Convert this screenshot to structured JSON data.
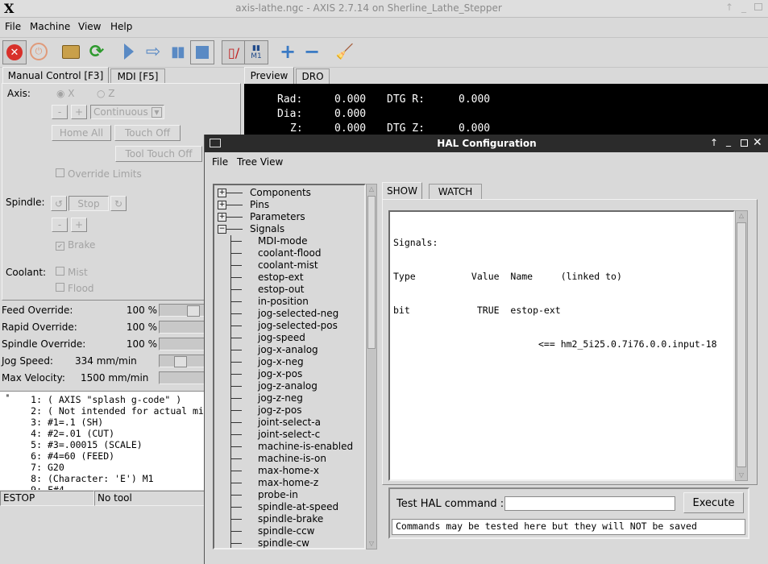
{
  "window": {
    "title": "axis-lathe.ngc - AXIS 2.7.14 on Sherline_Lathe_Stepper",
    "logo": "X"
  },
  "menubar": [
    "File",
    "Machine",
    "View",
    "Help"
  ],
  "tabs_left": {
    "manual": "Manual Control [F3]",
    "mdi": "MDI [F5]"
  },
  "tabs_right": {
    "preview": "Preview",
    "dro": "DRO"
  },
  "manual": {
    "axis_label": "Axis:",
    "axis_x": "X",
    "axis_z": "Z",
    "minus": "-",
    "plus": "+",
    "jog_mode": "Continuous",
    "home_all": "Home All",
    "touch_off": "Touch Off",
    "tool_touch_off": "Tool Touch Off",
    "override_limits": "Override Limits",
    "spindle_label": "Spindle:",
    "stop": "Stop",
    "brake": "Brake",
    "coolant_label": "Coolant:",
    "mist": "Mist",
    "flood": "Flood"
  },
  "overrides": [
    {
      "label": "Feed Override:",
      "value": "100 %"
    },
    {
      "label": "Rapid Override:",
      "value": "100 %"
    },
    {
      "label": "Spindle Override:",
      "value": "100 %"
    },
    {
      "label": "Jog Speed:",
      "value": "334 mm/min"
    },
    {
      "label": "Max Velocity:",
      "value": "1500 mm/min"
    }
  ],
  "gcode": [
    {
      "n": "1:",
      "t": "( AXIS \"splash g-code\" )"
    },
    {
      "n": "2:",
      "t": "( Not intended for actual mi"
    },
    {
      "n": "3:",
      "t": "#1=.1 (SH)"
    },
    {
      "n": "4:",
      "t": "#2=.01 (CUT)"
    },
    {
      "n": "5:",
      "t": "#3=.00015 (SCALE)"
    },
    {
      "n": "6:",
      "t": "#4=60 (FEED)"
    },
    {
      "n": "7:",
      "t": "G20"
    },
    {
      "n": "8:",
      "t": "(Character: 'E') M1"
    },
    {
      "n": "9:",
      "t": "F#4"
    }
  ],
  "status": {
    "estop": "ESTOP",
    "tool": "No tool"
  },
  "dro": {
    "rad_label": "Rad:",
    "rad": "0.000",
    "dtgr_label": "DTG R:",
    "dtgr": "0.000",
    "dia_label": "Dia:",
    "dia": "0.000",
    "z_label": "Z:",
    "z": "0.000",
    "dtgz_label": "DTG Z:",
    "dtgz": "0.000"
  },
  "hal": {
    "title": "HAL Configuration",
    "menu": [
      "File",
      "Tree View"
    ],
    "tree_roots": [
      "Components",
      "Pins",
      "Parameters",
      "Signals"
    ],
    "signals": [
      "MDI-mode",
      "coolant-flood",
      "coolant-mist",
      "estop-ext",
      "estop-out",
      "in-position",
      "jog-selected-neg",
      "jog-selected-pos",
      "jog-speed",
      "jog-x-analog",
      "jog-x-neg",
      "jog-x-pos",
      "jog-z-analog",
      "jog-z-neg",
      "jog-z-pos",
      "joint-select-a",
      "joint-select-c",
      "machine-is-enabled",
      "machine-is-on",
      "max-home-x",
      "max-home-z",
      "probe-in",
      "spindle-at-speed",
      "spindle-brake",
      "spindle-ccw",
      "spindle-cw"
    ],
    "tab_show": "SHOW",
    "tab_watch": "WATCH",
    "show_lines": [
      "Signals:",
      "Type          Value  Name     (linked to)",
      "bit            TRUE  estop-ext",
      "                          <== hm2_5i25.0.7i76.0.0.input-18"
    ],
    "test_label": "Test HAL command :",
    "test_value": "",
    "execute": "Execute",
    "note": "Commands may be tested here but they will NOT be saved"
  },
  "colors": {
    "dro_bg": "#000000",
    "dro_fg": "#ffffff",
    "titlebar_active": "#2b2b2b"
  }
}
